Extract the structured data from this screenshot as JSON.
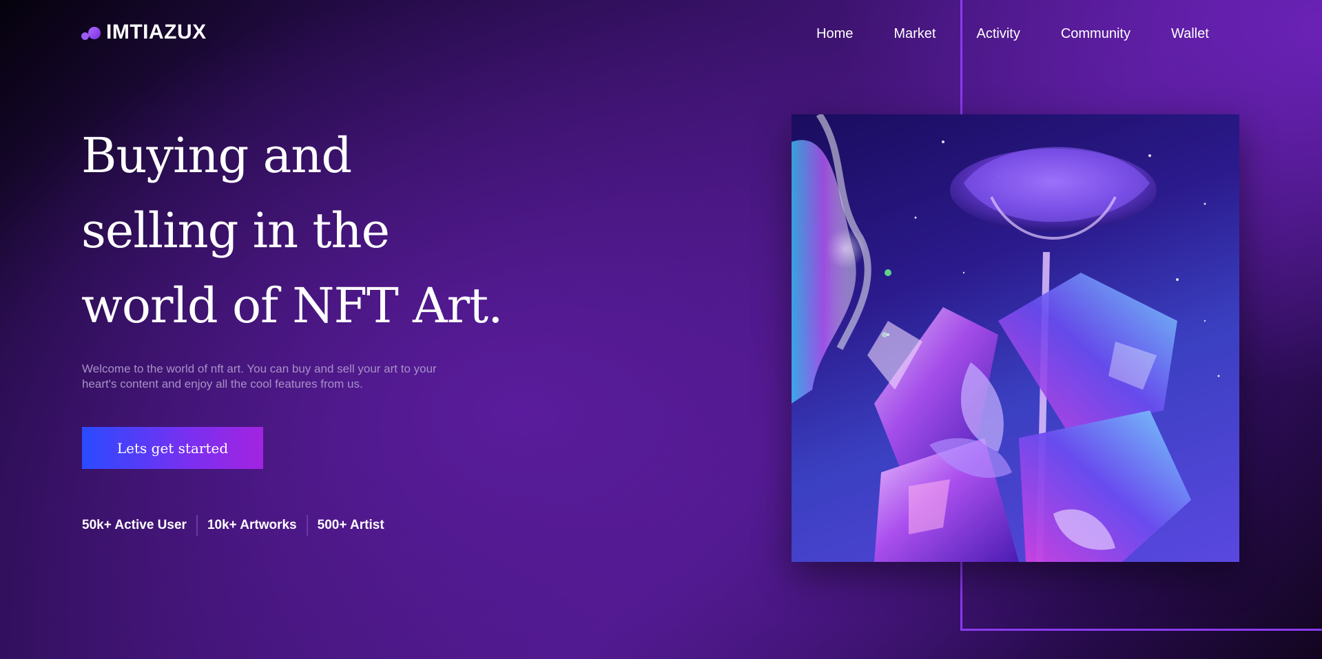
{
  "brand": {
    "name": "IMTIAZUX"
  },
  "nav": {
    "items": [
      {
        "label": "Home"
      },
      {
        "label": "Market"
      },
      {
        "label": "Activity"
      },
      {
        "label": "Community"
      },
      {
        "label": "Wallet"
      }
    ]
  },
  "hero": {
    "title_line1": "Buying and",
    "title_line2": "selling in the",
    "title_line3": "world of NFT Art.",
    "description": "Welcome to the world of nft art. You can buy and sell your art to your heart's content and enjoy all the cool features from us.",
    "cta_label": "Lets get started"
  },
  "stats": [
    {
      "label": "50k+ Active User"
    },
    {
      "label": "10k+ Artworks"
    },
    {
      "label": "500+ Artist"
    }
  ],
  "colors": {
    "accent": "#8a3bf0",
    "cta_start": "#2a4bff",
    "cta_end": "#a224e0",
    "background_dark": "#05020c",
    "background_purple": "#5a1c9c"
  }
}
